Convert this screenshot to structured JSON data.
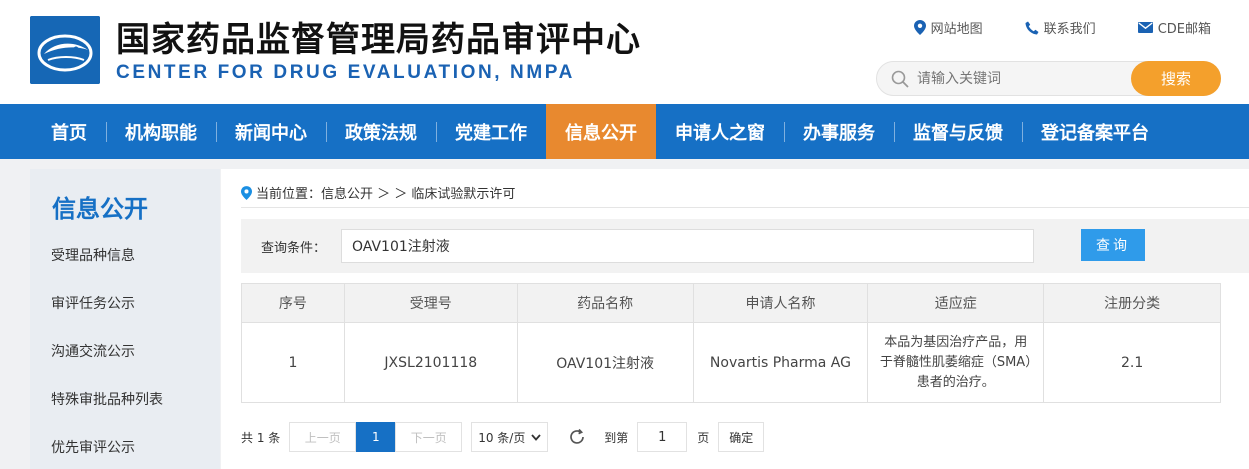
{
  "header": {
    "title_cn": "国家药品监督管理局药品审评中心",
    "title_en": "CENTER FOR DRUG EVALUATION, NMPA",
    "links": [
      {
        "label": "网站地图",
        "icon": "map-pin-icon"
      },
      {
        "label": "联系我们",
        "icon": "phone-icon"
      },
      {
        "label": "CDE邮箱",
        "icon": "mail-icon"
      }
    ],
    "search": {
      "placeholder": "请输入关键词",
      "button": "搜索"
    }
  },
  "nav": {
    "items": [
      "首页",
      "机构职能",
      "新闻中心",
      "政策法规",
      "党建工作",
      "信息公开",
      "申请人之窗",
      "办事服务",
      "监督与反馈",
      "登记备案平台"
    ],
    "active": "信息公开"
  },
  "sidebar": {
    "title": "信息公开",
    "items": [
      "受理品种信息",
      "审评任务公示",
      "沟通交流公示",
      "特殊审批品种列表",
      "优先审评公示"
    ]
  },
  "breadcrumb": {
    "label": "当前位置：信息公开 ＞ ＞ 临床试验默示许可"
  },
  "query": {
    "label": "查询条件：",
    "value": "OAV101注射液",
    "button": "查询"
  },
  "table": {
    "headers": [
      "序号",
      "受理号",
      "药品名称",
      "申请人名称",
      "适应症",
      "注册分类"
    ],
    "rows": [
      {
        "index": "1",
        "accept_no": "JXSL2101118",
        "drug_name": "OAV101注射液",
        "applicant": "Novartis Pharma AG",
        "indication": "本品为基因治疗产品，用于脊髓性肌萎缩症（SMA）患者的治疗。",
        "category": "2.1"
      }
    ]
  },
  "pager": {
    "total": "共 1 条",
    "prev": "上一页",
    "current": "1",
    "next": "下一页",
    "page_size": "10 条/页",
    "goto_label": "到第",
    "goto_value": "1",
    "page_unit": "页",
    "confirm": "确定"
  },
  "colors": {
    "nav_bg": "#1670c5",
    "nav_active": "#e8892f",
    "search_button": "#f4a02c",
    "query_button": "#2f9bea"
  }
}
